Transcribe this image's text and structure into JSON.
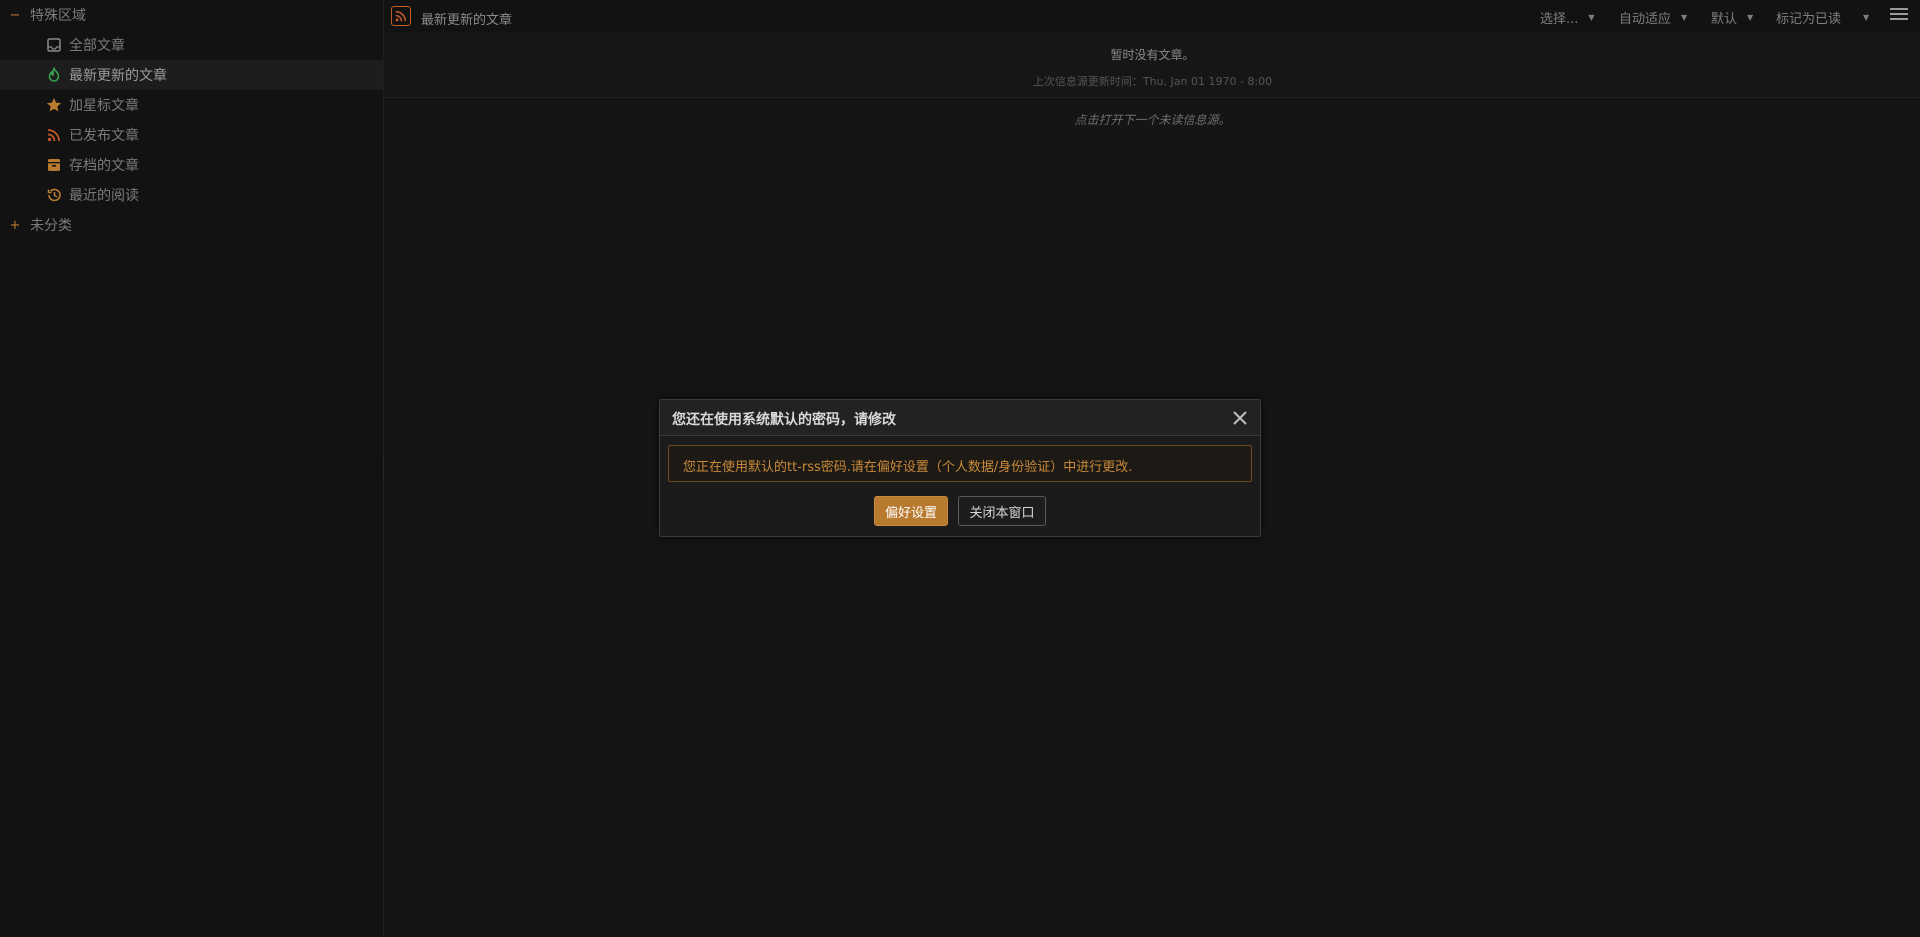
{
  "sidebar": {
    "special_category": {
      "label": "特殊区域",
      "toggle": "−"
    },
    "feeds": [
      {
        "label": "全部文章",
        "icon": "inbox-icon"
      },
      {
        "label": "最新更新的文章",
        "icon": "fire-icon",
        "selected": true
      },
      {
        "label": "加星标文章",
        "icon": "star-icon"
      },
      {
        "label": "已发布文章",
        "icon": "rss-icon"
      },
      {
        "label": "存档的文章",
        "icon": "archive-icon"
      },
      {
        "label": "最近的阅读",
        "icon": "history-icon"
      }
    ],
    "uncategorized": {
      "label": "未分类",
      "toggle": "+"
    }
  },
  "toolbar": {
    "feed_title": "最新更新的文章",
    "select_label": "选择...",
    "view_mode_label": "自动适应",
    "order_label": "默认",
    "mark_read_label": "标记为已读"
  },
  "headlines": {
    "no_articles": "暂时没有文章。",
    "last_update": "上次信息源更新时间：Thu, Jan 01 1970 - 8:00",
    "open_next": "点击打开下一个未读信息源。"
  },
  "dialog": {
    "title": "您还在使用系统默认的密码，请修改",
    "message": "您正在使用默认的tt-rss密码.请在偏好设置（个人数据/身份验证）中进行更改.",
    "prefs_button": "偏好设置",
    "close_button": "关闭本窗口"
  },
  "colors": {
    "accent": "#b87a2e",
    "background": "#141414",
    "rss": "#c75b2a"
  }
}
